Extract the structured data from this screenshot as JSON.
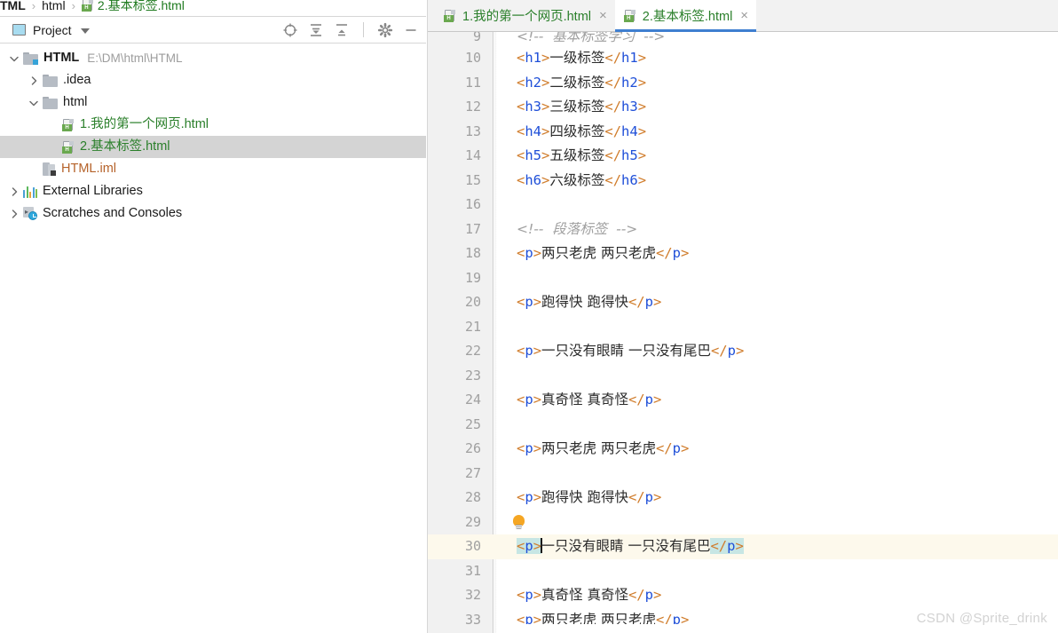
{
  "breadcrumb": {
    "crumb1": "TML",
    "sep": "›",
    "crumb2": "html",
    "file": "2.基本标签.html"
  },
  "project_panel": {
    "title": "Project",
    "dropdown_icon": "chevron-down-icon",
    "toolbar": [
      {
        "name": "locate-icon",
        "label": "Select Opened File"
      },
      {
        "name": "expand-all-icon",
        "label": "Expand All"
      },
      {
        "name": "collapse-all-icon",
        "label": "Collapse All"
      },
      {
        "name": "gear-icon",
        "label": "Settings"
      },
      {
        "name": "minimize-icon",
        "label": "Hide"
      }
    ],
    "tree": [
      {
        "label": "HTML",
        "path": "E:\\DM\\html\\HTML",
        "icon": "module-folder-icon",
        "indent": 0,
        "arrow": "down",
        "style": "bold",
        "selected": false
      },
      {
        "label": ".idea",
        "path": "",
        "icon": "folder-icon",
        "indent": 1,
        "arrow": "right",
        "style": "plain",
        "selected": false
      },
      {
        "label": "html",
        "path": "",
        "icon": "folder-icon",
        "indent": 1,
        "arrow": "down",
        "style": "plain",
        "selected": false
      },
      {
        "label": "1.我的第一个网页.html",
        "path": "",
        "icon": "html-file-icon",
        "indent": 2,
        "arrow": "none",
        "style": "green",
        "selected": false
      },
      {
        "label": "2.基本标签.html",
        "path": "",
        "icon": "html-file-icon",
        "indent": 2,
        "arrow": "none",
        "style": "green",
        "selected": true
      },
      {
        "label": "HTML.iml",
        "path": "",
        "icon": "iml-file-icon",
        "indent": 1,
        "arrow": "none",
        "style": "orange",
        "selected": false
      },
      {
        "label": "External Libraries",
        "path": "",
        "icon": "external-libraries-icon",
        "indent": 0,
        "arrow": "right",
        "style": "plain",
        "selected": false
      },
      {
        "label": "Scratches and Consoles",
        "path": "",
        "icon": "scratches-icon",
        "indent": 0,
        "arrow": "right",
        "style": "plain",
        "selected": false
      }
    ]
  },
  "editor": {
    "tabs": [
      {
        "label": "1.我的第一个网页.html",
        "active": false,
        "close": "×"
      },
      {
        "label": "2.基本标签.html",
        "active": true,
        "close": "×"
      }
    ],
    "lines": [
      {
        "no": "9",
        "type": "comment",
        "text": "<!--  基本标签学习  -->",
        "current": false,
        "clipped_top": true
      },
      {
        "no": "10",
        "type": "tag",
        "tag": "h1",
        "content": "一级标签",
        "current": false
      },
      {
        "no": "11",
        "type": "tag",
        "tag": "h2",
        "content": "二级标签",
        "current": false
      },
      {
        "no": "12",
        "type": "tag",
        "tag": "h3",
        "content": "三级标签",
        "current": false
      },
      {
        "no": "13",
        "type": "tag",
        "tag": "h4",
        "content": "四级标签",
        "current": false
      },
      {
        "no": "14",
        "type": "tag",
        "tag": "h5",
        "content": "五级标签",
        "current": false
      },
      {
        "no": "15",
        "type": "tag",
        "tag": "h6",
        "content": "六级标签",
        "current": false
      },
      {
        "no": "16",
        "type": "blank",
        "current": false
      },
      {
        "no": "17",
        "type": "comment",
        "text": "<!--  段落标签  -->",
        "current": false
      },
      {
        "no": "18",
        "type": "tag",
        "tag": "p",
        "content": "两只老虎 两只老虎",
        "current": false
      },
      {
        "no": "19",
        "type": "blank",
        "current": false
      },
      {
        "no": "20",
        "type": "tag",
        "tag": "p",
        "content": "跑得快 跑得快",
        "current": false
      },
      {
        "no": "21",
        "type": "blank",
        "current": false
      },
      {
        "no": "22",
        "type": "tag",
        "tag": "p",
        "content": "一只没有眼睛 一只没有尾巴",
        "current": false
      },
      {
        "no": "23",
        "type": "blank",
        "current": false
      },
      {
        "no": "24",
        "type": "tag",
        "tag": "p",
        "content": "真奇怪 真奇怪",
        "current": false
      },
      {
        "no": "25",
        "type": "blank",
        "current": false
      },
      {
        "no": "26",
        "type": "tag",
        "tag": "p",
        "content": "两只老虎 两只老虎",
        "current": false
      },
      {
        "no": "27",
        "type": "blank",
        "current": false
      },
      {
        "no": "28",
        "type": "tag",
        "tag": "p",
        "content": "跑得快 跑得快",
        "current": false
      },
      {
        "no": "29",
        "type": "blank",
        "current": false,
        "bulb": true
      },
      {
        "no": "30",
        "type": "tag-highlight",
        "tag": "p",
        "content": "一只没有眼睛 一只没有尾巴",
        "current": true,
        "caret": true
      },
      {
        "no": "31",
        "type": "blank",
        "current": false
      },
      {
        "no": "32",
        "type": "tag",
        "tag": "p",
        "content": "真奇怪 真奇怪",
        "current": false
      },
      {
        "no": "33",
        "type": "tag",
        "tag": "p",
        "content": "两只老虎 两只老虎",
        "current": false,
        "clipped_bottom": true
      }
    ]
  },
  "watermark": "CSDN @Sprite_drink",
  "colors": {
    "tag_punct": "#d07c2b",
    "tag_name": "#1f4fd8",
    "comment": "#a0a0a0",
    "match_highlight": "#c7e6e4",
    "current_line": "#fdf9ec",
    "selection": "#d4d4d4",
    "active_tab_underline": "#3f7fd0",
    "green_file": "#2a7f2a",
    "orange_file": "#b5622a"
  }
}
